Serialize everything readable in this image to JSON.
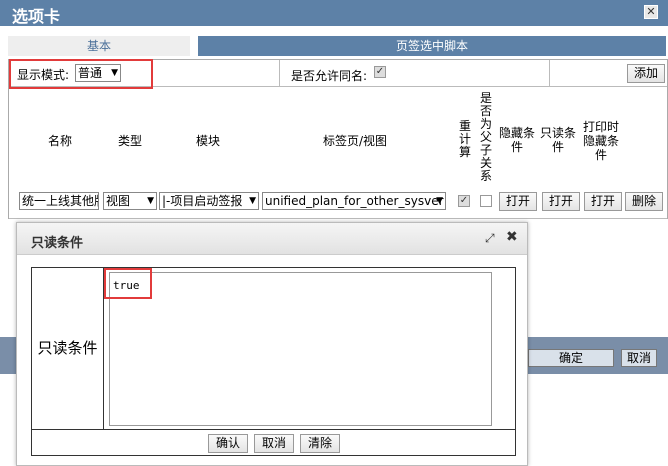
{
  "window": {
    "title": "选项卡",
    "close_symbol": "✕"
  },
  "tabs": [
    {
      "label": "基本"
    },
    {
      "label": "页签选中脚本"
    }
  ],
  "form": {
    "display_mode_label": "显示模式:",
    "display_mode_value": "普通",
    "allow_duplicate_label": "是否允许同名:",
    "allow_duplicate_checked": true,
    "add_button": "添加"
  },
  "grid": {
    "headers": {
      "name": "名称",
      "type": "类型",
      "module": "模块",
      "tab_view": "标签页/视图",
      "recalc": "重计算",
      "parent_child": "是否为父子关系",
      "hide_cond": "隐藏条件",
      "readonly_cond": "只读条件",
      "print_hide_cond": "打印时隐藏条件"
    },
    "row": {
      "name": "统一上线其他版",
      "type": "视图",
      "module": "|-项目启动签报",
      "tab_view": "unified_plan_for_other_sysver",
      "recalc_checked": true,
      "parent_child_checked": false,
      "open1": "打开",
      "open2": "打开",
      "open3": "打开",
      "delete": "删除"
    }
  },
  "background_buttons": {
    "confirm": "确定",
    "cancel": "取消"
  },
  "dialog": {
    "title": "只读条件",
    "max_symbol": "⤢",
    "close_symbol": "✖",
    "label": "只读条件",
    "textarea_value": "true",
    "buttons": {
      "ok": "确认",
      "cancel": "取消",
      "clear": "清除"
    }
  },
  "colors": {
    "title_bar": "#5d81a7",
    "highlight": "#e23b3b"
  }
}
